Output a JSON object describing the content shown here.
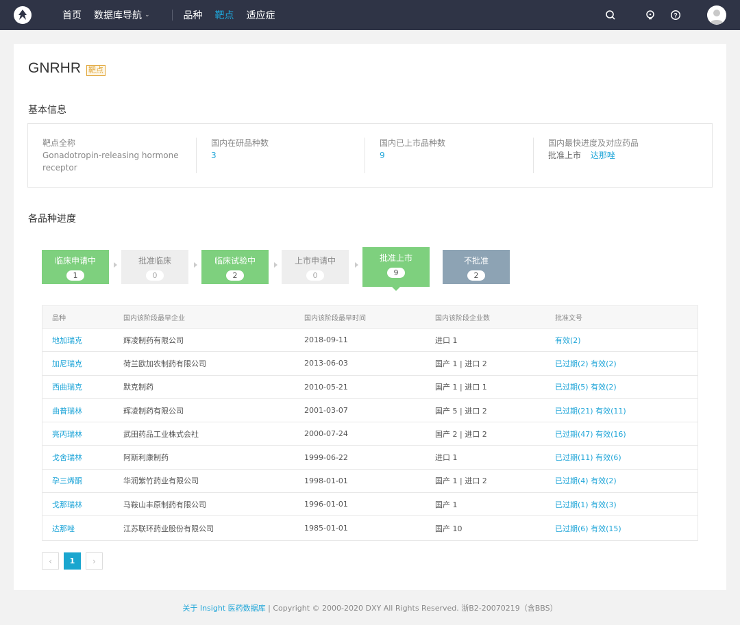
{
  "nav": {
    "items": [
      {
        "label": "首页"
      },
      {
        "label": "数据库导航"
      }
    ],
    "items2": [
      {
        "label": "品种"
      },
      {
        "label": "靶点"
      },
      {
        "label": "适应症"
      }
    ],
    "chevron": "⌄",
    "icons": [
      "search-icon",
      "lightbulb-icon",
      "help-icon"
    ]
  },
  "page": {
    "title": "GNRHR",
    "tag": "靶点"
  },
  "basic_info": {
    "section_title": "基本信息",
    "cols": [
      {
        "label": "靶点全称",
        "value_line1": "Gonadotropin-releasing hormone",
        "value_line2": "receptor"
      },
      {
        "label": "国内在研品种数",
        "value": "3"
      },
      {
        "label": "国内已上市品种数",
        "value": "9"
      },
      {
        "label": "国内最快进度及对应药品",
        "value_status": "批准上市",
        "value_drug": "达那唑"
      }
    ]
  },
  "progress": {
    "section_title": "各品种进度",
    "stages": [
      {
        "label": "临床申请中",
        "count": "1"
      },
      {
        "label": "批准临床",
        "count": "0"
      },
      {
        "label": "临床试验中",
        "count": "2"
      },
      {
        "label": "上市申请中",
        "count": "0"
      },
      {
        "label": "批准上市",
        "count": "9"
      },
      {
        "label": "不批准",
        "count": "2"
      }
    ]
  },
  "table": {
    "headers": [
      "品种",
      "国内该阶段最早企业",
      "国内该阶段最早时间",
      "国内该阶段企业数",
      "批准文号"
    ],
    "rows": [
      {
        "name": "地加瑞克",
        "company": "辉凌制药有限公司",
        "date": "2018-09-11",
        "count": "进口 1",
        "approval": "有效(2)"
      },
      {
        "name": "加尼瑞克",
        "company": "荷兰欧加农制药有限公司",
        "date": "2013-06-03",
        "count": "国产 1 | 进口 2",
        "approval": "已过期(2) 有效(2)"
      },
      {
        "name": "西曲瑞克",
        "company": "默克制药",
        "date": "2010-05-21",
        "count": "国产 1 | 进口 1",
        "approval": "已过期(5) 有效(2)"
      },
      {
        "name": "曲普瑞林",
        "company": "辉凌制药有限公司",
        "date": "2001-03-07",
        "count": "国产 5 | 进口 2",
        "approval": "已过期(21) 有效(11)"
      },
      {
        "name": "亮丙瑞林",
        "company": "武田药品工业株式会社",
        "date": "2000-07-24",
        "count": "国产 2 | 进口 2",
        "approval": "已过期(47) 有效(16)"
      },
      {
        "name": "戈舍瑞林",
        "company": "阿斯利康制药",
        "date": "1999-06-22",
        "count": "进口 1",
        "approval": "已过期(11) 有效(6)"
      },
      {
        "name": "孕三烯酮",
        "company": "华润紫竹药业有限公司",
        "date": "1998-01-01",
        "count": "国产 1 | 进口 2",
        "approval": "已过期(4) 有效(2)"
      },
      {
        "name": "戈那瑞林",
        "company": "马鞍山丰原制药有限公司",
        "date": "1996-01-01",
        "count": "国产 1",
        "approval": "已过期(1) 有效(3)"
      },
      {
        "name": "达那唑",
        "company": "江苏联环药业股份有限公司",
        "date": "1985-01-01",
        "count": "国产 10",
        "approval": "已过期(6) 有效(15)"
      }
    ]
  },
  "pagination": {
    "prev": "‹",
    "current": "1",
    "next": "›"
  },
  "footer": {
    "link": "关于 Insight 医药数据库",
    "sep": " | ",
    "text": "Copyright © 2000-2020 DXY All Rights Reserved. 浙B2-20070219（含BBS）"
  }
}
